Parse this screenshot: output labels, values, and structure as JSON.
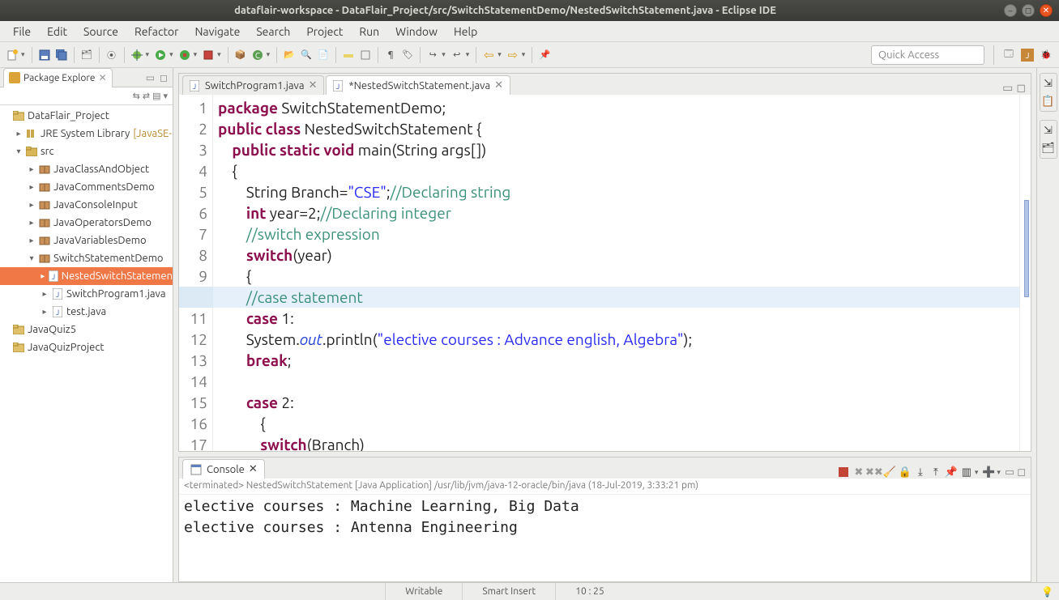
{
  "window": {
    "title": "dataflair-workspace - DataFlair_Project/src/SwitchStatementDemo/NestedSwitchStatement.java - Eclipse IDE"
  },
  "menu": [
    "File",
    "Edit",
    "Source",
    "Refactor",
    "Navigate",
    "Search",
    "Project",
    "Run",
    "Window",
    "Help"
  ],
  "quick_access_placeholder": "Quick Access",
  "package_explorer": {
    "title": "Package Explore",
    "tree": [
      {
        "ind": 0,
        "arw": "",
        "type": "proj",
        "label": "DataFlair_Project"
      },
      {
        "ind": 1,
        "arw": "▸",
        "type": "lib",
        "label": "JRE System Library",
        "suffix": "[JavaSE-"
      },
      {
        "ind": 1,
        "arw": "▾",
        "type": "fold",
        "label": "src"
      },
      {
        "ind": 2,
        "arw": "▸",
        "type": "pkg",
        "label": "JavaClassAndObject"
      },
      {
        "ind": 2,
        "arw": "▸",
        "type": "pkg",
        "label": "JavaCommentsDemo"
      },
      {
        "ind": 2,
        "arw": "▸",
        "type": "pkg",
        "label": "JavaConsoleInput"
      },
      {
        "ind": 2,
        "arw": "▸",
        "type": "pkg",
        "label": "JavaOperatorsDemo"
      },
      {
        "ind": 2,
        "arw": "▸",
        "type": "pkg",
        "label": "JavaVariablesDemo"
      },
      {
        "ind": 2,
        "arw": "▾",
        "type": "pkg",
        "label": "SwitchStatementDemo"
      },
      {
        "ind": 3,
        "arw": "▸",
        "type": "jfile",
        "label": "NestedSwitchStatemen",
        "sel": true
      },
      {
        "ind": 3,
        "arw": "▸",
        "type": "jfile",
        "label": "SwitchProgram1.java"
      },
      {
        "ind": 3,
        "arw": "▸",
        "type": "jfile",
        "label": "test.java"
      },
      {
        "ind": 0,
        "arw": "",
        "type": "proj",
        "label": "JavaQuiz5"
      },
      {
        "ind": 0,
        "arw": "",
        "type": "proj",
        "label": "JavaQuizProject"
      }
    ]
  },
  "editor": {
    "tabs": [
      {
        "label": "SwitchProgram1.java",
        "active": false,
        "dirty": false
      },
      {
        "label": "NestedSwitchStatement.java",
        "active": true,
        "dirty": true
      }
    ],
    "highlight_line": 10,
    "lines": [
      [
        {
          "c": "kw",
          "t": "package"
        },
        {
          "c": "plain",
          "t": " SwitchStatementDemo;"
        }
      ],
      [
        {
          "c": "kw",
          "t": "public"
        },
        {
          "c": "plain",
          "t": " "
        },
        {
          "c": "kw",
          "t": "class"
        },
        {
          "c": "plain",
          "t": " NestedSwitchStatement {"
        }
      ],
      [
        {
          "c": "plain",
          "t": "    "
        },
        {
          "c": "kw",
          "t": "public"
        },
        {
          "c": "plain",
          "t": " "
        },
        {
          "c": "kw",
          "t": "static"
        },
        {
          "c": "plain",
          "t": " "
        },
        {
          "c": "kw",
          "t": "void"
        },
        {
          "c": "plain",
          "t": " main(String args[])"
        }
      ],
      [
        {
          "c": "plain",
          "t": "    {"
        }
      ],
      [
        {
          "c": "plain",
          "t": "        String Branch="
        },
        {
          "c": "str",
          "t": "\"CSE\""
        },
        {
          "c": "plain",
          "t": ";"
        },
        {
          "c": "com",
          "t": "//Declaring string"
        }
      ],
      [
        {
          "c": "plain",
          "t": "        "
        },
        {
          "c": "kw",
          "t": "int"
        },
        {
          "c": "plain",
          "t": " year=2;"
        },
        {
          "c": "com",
          "t": "//Declaring integer"
        }
      ],
      [
        {
          "c": "plain",
          "t": "        "
        },
        {
          "c": "com",
          "t": "//switch expression"
        }
      ],
      [
        {
          "c": "plain",
          "t": "        "
        },
        {
          "c": "kw",
          "t": "switch"
        },
        {
          "c": "plain",
          "t": "(year)"
        }
      ],
      [
        {
          "c": "plain",
          "t": "        {"
        }
      ],
      [
        {
          "c": "plain",
          "t": "        "
        },
        {
          "c": "com",
          "t": "//case statement"
        }
      ],
      [
        {
          "c": "plain",
          "t": "        "
        },
        {
          "c": "kw",
          "t": "case"
        },
        {
          "c": "plain",
          "t": " 1:"
        }
      ],
      [
        {
          "c": "plain",
          "t": "        System."
        },
        {
          "c": "field",
          "t": "out"
        },
        {
          "c": "plain",
          "t": ".println("
        },
        {
          "c": "str",
          "t": "\"elective courses : Advance english, Algebra\""
        },
        {
          "c": "plain",
          "t": ");"
        }
      ],
      [
        {
          "c": "plain",
          "t": "        "
        },
        {
          "c": "kw",
          "t": "break"
        },
        {
          "c": "plain",
          "t": ";"
        }
      ],
      [
        {
          "c": "plain",
          "t": ""
        }
      ],
      [
        {
          "c": "plain",
          "t": "        "
        },
        {
          "c": "kw",
          "t": "case"
        },
        {
          "c": "plain",
          "t": " 2:"
        }
      ],
      [
        {
          "c": "plain",
          "t": "            {"
        }
      ],
      [
        {
          "c": "plain",
          "t": "            "
        },
        {
          "c": "kw",
          "t": "switch"
        },
        {
          "c": "plain",
          "t": "(Branch)"
        }
      ]
    ]
  },
  "console": {
    "title": "Console",
    "info": "<terminated> NestedSwitchStatement [Java Application] /usr/lib/jvm/java-12-oracle/bin/java (18-Jul-2019, 3:33:21 pm)",
    "out": "elective courses : Machine Learning, Big Data\nelective courses : Antenna Engineering"
  },
  "status": {
    "writable": "Writable",
    "insert": "Smart Insert",
    "pos": "10 : 25"
  }
}
